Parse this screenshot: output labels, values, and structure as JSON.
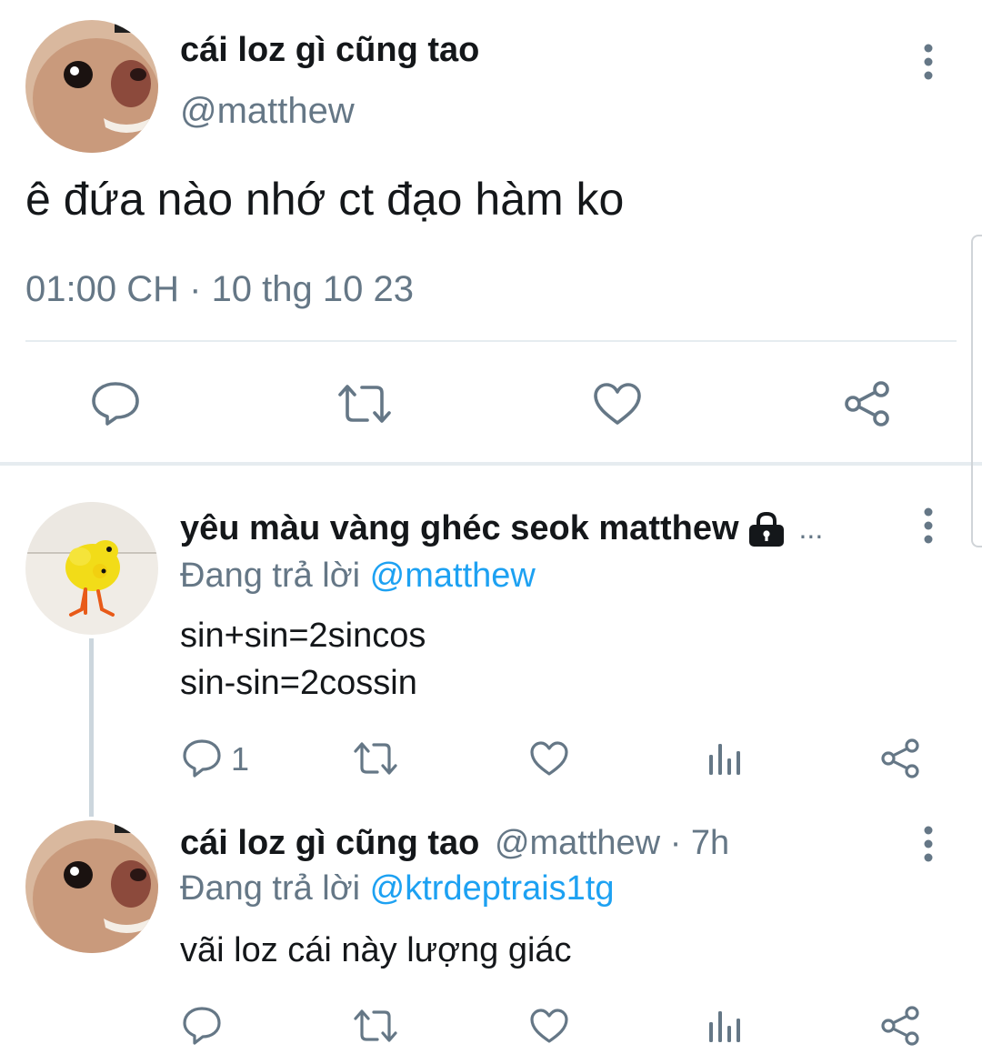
{
  "main_tweet": {
    "author_name": "cái loz gì cũng tao",
    "author_handle": "@matthew",
    "text": "ê đứa nào nhớ ct đạo hàm ko",
    "time": "01:00 CH",
    "separator": "·",
    "date": "10 thg 10 23",
    "actions": [
      "reply-icon",
      "retweet-icon",
      "like-icon",
      "share-icon"
    ]
  },
  "reply1": {
    "author_name": "yêu màu vàng ghéc seok matthew",
    "lock_icon": "lock-icon",
    "ellipsis": "...",
    "replying_prefix": "Đang trả lời",
    "replying_to": "@matthew",
    "text_line1": "sin+sin=2sincos",
    "text_line2": "sin-sin=2cossin",
    "reply_count": "1"
  },
  "reply2": {
    "author_name": "cái loz gì cũng tao",
    "author_handle": "@matthew",
    "separator": "·",
    "time_ago": "7h",
    "replying_prefix": "Đang trả lời",
    "replying_to": "@ktrdeptrais1tg",
    "text": "vãi loz cái này lượng giác"
  },
  "colors": {
    "accent": "#1da1f2",
    "muted": "#657786",
    "text": "#14171a",
    "divider": "#e6ecf0"
  }
}
